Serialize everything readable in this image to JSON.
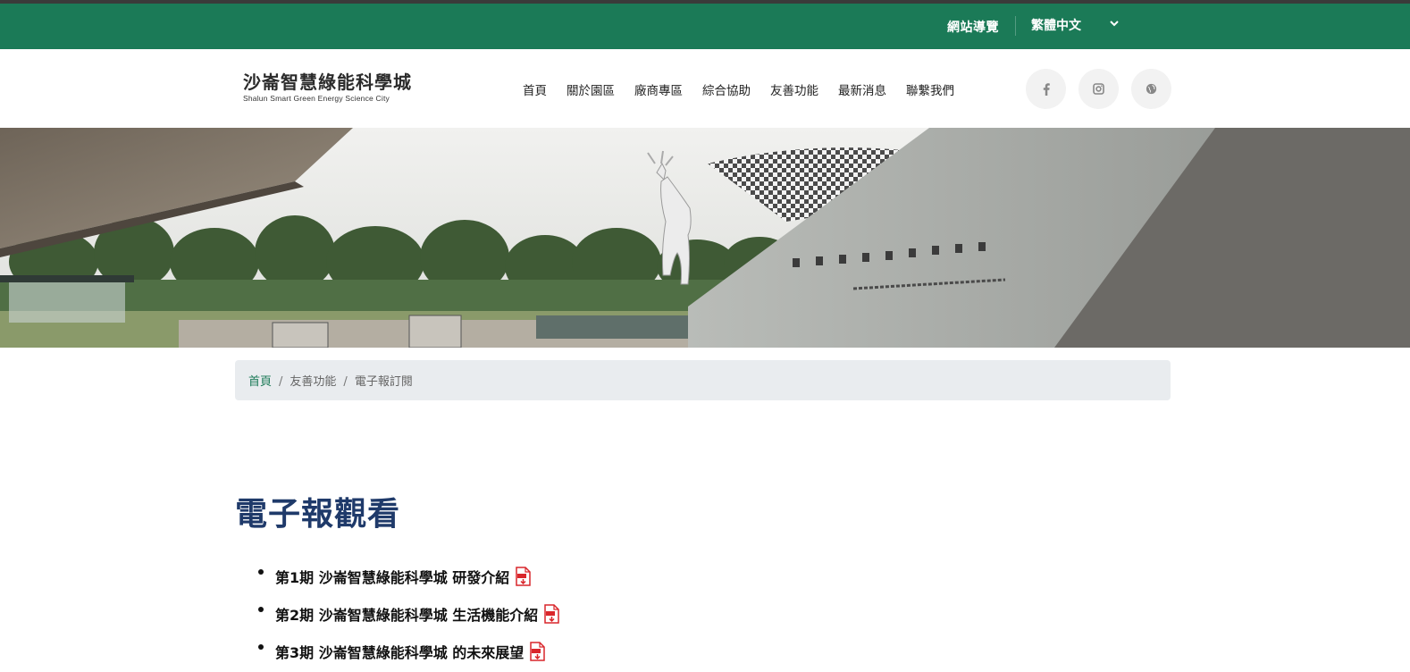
{
  "topbar": {
    "sitemap_label": "網站導覽",
    "language_label": "繁體中文",
    "background_color": "#1b7a57"
  },
  "logo": {
    "name_zh": "沙崙智慧綠能科學城",
    "name_en": "Shalun Smart Green Energy Science City"
  },
  "nav": {
    "items": [
      "首頁",
      "關於園區",
      "廠商專區",
      "綜合協助",
      "友善功能",
      "最新消息",
      "聯繫我們"
    ]
  },
  "social": {
    "icons": [
      "facebook-icon",
      "instagram-icon",
      "globe-icon"
    ]
  },
  "breadcrumb": {
    "home": "首頁",
    "level1": "友善功能",
    "current": "電子報訂閱",
    "separator": "/"
  },
  "main": {
    "title": "電子報觀看",
    "issues": [
      {
        "label": "第1期 沙崙智慧綠能科學城 研發介紹",
        "icon": "pdf-icon"
      },
      {
        "label": "第2期 沙崙智慧綠能科學城 生活機能介紹",
        "icon": "pdf-icon"
      },
      {
        "label": "第3期 沙崙智慧綠能科學城 的未來展望",
        "icon": "pdf-icon"
      }
    ]
  },
  "colors": {
    "accent_green": "#1b7a57",
    "title_blue": "#1f3a6a",
    "pdf_red": "#d9262b",
    "breadcrumb_bg": "#e9ecef"
  }
}
